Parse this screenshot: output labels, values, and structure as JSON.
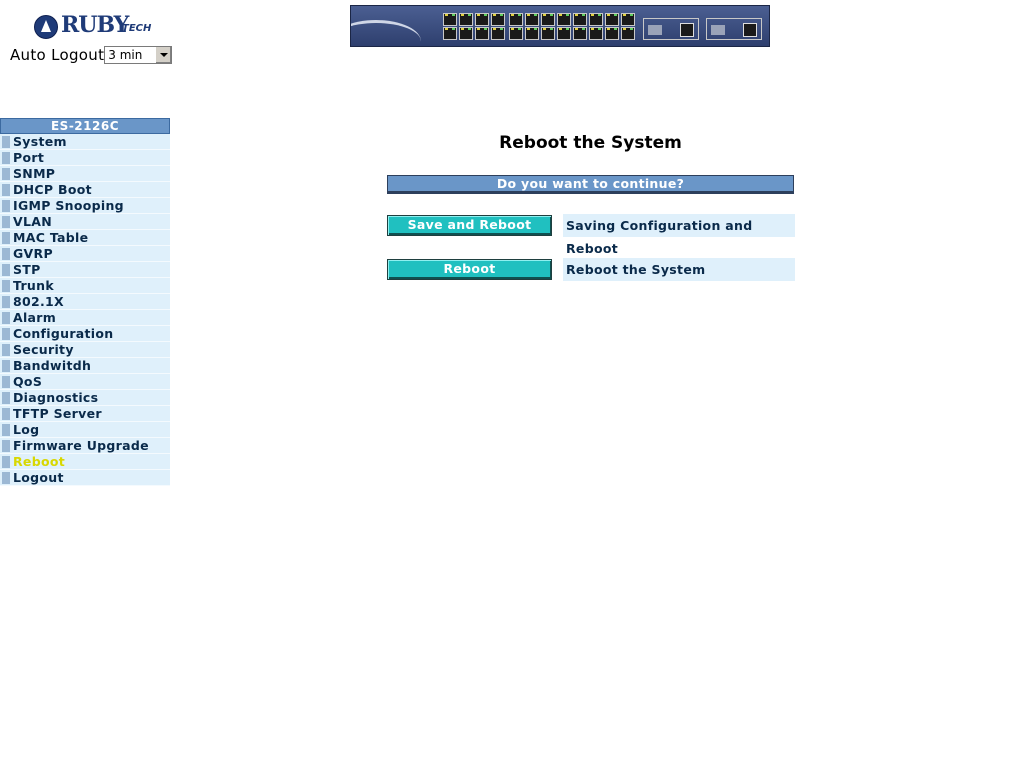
{
  "header": {
    "logo_text": "RUBY",
    "logo_suffix": "TECH",
    "auto_logout_label": "Auto Logout",
    "auto_logout_value": "3 min"
  },
  "sidebar": {
    "title": "ES-2126C",
    "items": [
      {
        "label": "System"
      },
      {
        "label": "Port"
      },
      {
        "label": "SNMP"
      },
      {
        "label": "DHCP Boot"
      },
      {
        "label": "IGMP Snooping"
      },
      {
        "label": "VLAN"
      },
      {
        "label": "MAC Table"
      },
      {
        "label": "GVRP"
      },
      {
        "label": "STP"
      },
      {
        "label": "Trunk"
      },
      {
        "label": "802.1X"
      },
      {
        "label": "Alarm"
      },
      {
        "label": "Configuration"
      },
      {
        "label": "Security"
      },
      {
        "label": "Bandwitdh"
      },
      {
        "label": "QoS"
      },
      {
        "label": "Diagnostics"
      },
      {
        "label": "TFTP Server"
      },
      {
        "label": "Log"
      },
      {
        "label": "Firmware Upgrade"
      },
      {
        "label": "Reboot",
        "active": true
      },
      {
        "label": "Logout"
      }
    ]
  },
  "main": {
    "title": "Reboot the System",
    "confirm_text": "Do you want to continue?",
    "actions": [
      {
        "button": "Save and Reboot",
        "description": "Saving Configuration and Reboot"
      },
      {
        "button": "Reboot",
        "description": "Reboot the System"
      }
    ]
  },
  "colors": {
    "nav_header": "#6a96c8",
    "nav_item_bg": "#dff0fb",
    "active_item_text": "#d8d800",
    "action_button": "#20c0c0"
  }
}
